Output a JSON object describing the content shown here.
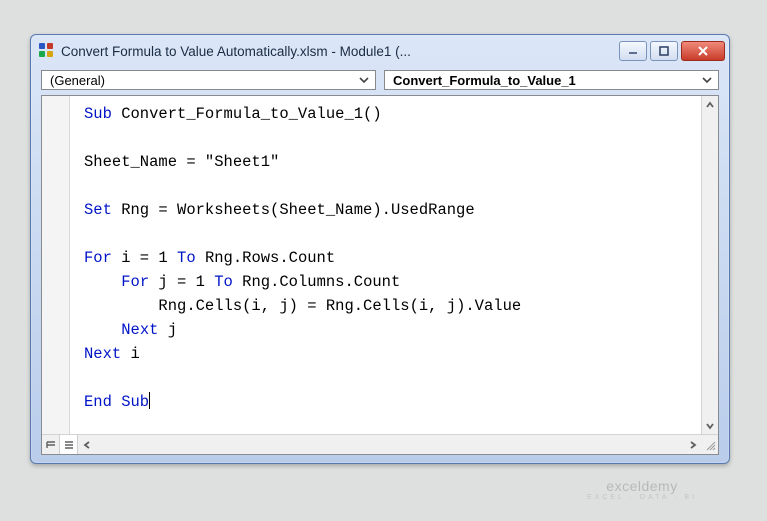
{
  "window": {
    "title": "Convert Formula to Value Automatically.xlsm - Module1 (..."
  },
  "dropdowns": {
    "object": "(General)",
    "procedure": "Convert_Formula_to_Value_1"
  },
  "code": {
    "kw1": "Sub",
    "sub_name": " Convert_Formula_to_Value_1()",
    "line_assign": "Sheet_Name = \"Sheet1\"",
    "kw_set": "Set",
    "line_set": " Rng = Worksheets(Sheet_Name).UsedRange",
    "kw_for": "For",
    "for_i": " i = 1 ",
    "kw_to": "To",
    "rows_count": " Rng.Rows.Count",
    "for_j_indent": "    ",
    "for_j": " j = 1 ",
    "cols_count": " Rng.Columns.Count",
    "cell_line_indent": "        ",
    "cell_line": "Rng.Cells(i, j) = Rng.Cells(i, j).Value",
    "next_j_indent": "    ",
    "kw_next": "Next",
    "next_j": " j",
    "next_i": " i",
    "kw_end_sub": "End Sub"
  },
  "watermark": {
    "brand": "exceldemy",
    "tag": "EXCEL · DATA · BI"
  }
}
